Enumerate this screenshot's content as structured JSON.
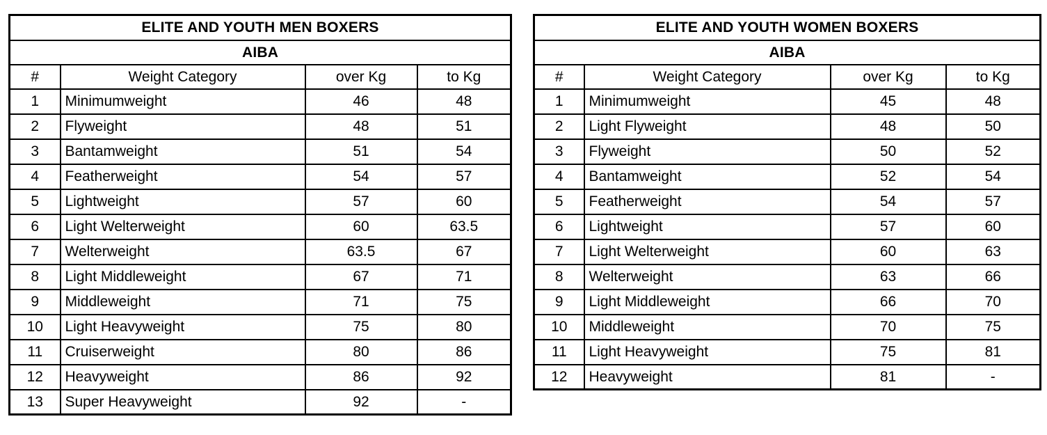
{
  "tables": [
    {
      "id": "men",
      "title": "ELITE AND YOUTH MEN BOXERS",
      "organization": "AIBA",
      "columns": {
        "index": "#",
        "category": "Weight Category",
        "over": "over Kg",
        "to": "to Kg"
      },
      "rows": [
        {
          "index": "1",
          "category": "Minimumweight",
          "over": "46",
          "to": "48"
        },
        {
          "index": "2",
          "category": "Flyweight",
          "over": "48",
          "to": "51"
        },
        {
          "index": "3",
          "category": "Bantamweight",
          "over": "51",
          "to": "54"
        },
        {
          "index": "4",
          "category": "Featherweight",
          "over": "54",
          "to": "57"
        },
        {
          "index": "5",
          "category": "Lightweight",
          "over": "57",
          "to": "60"
        },
        {
          "index": "6",
          "category": "Light Welterweight",
          "over": "60",
          "to": "63.5"
        },
        {
          "index": "7",
          "category": "Welterweight",
          "over": "63.5",
          "to": "67"
        },
        {
          "index": "8",
          "category": "Light Middleweight",
          "over": "67",
          "to": "71"
        },
        {
          "index": "9",
          "category": "Middleweight",
          "over": "71",
          "to": "75"
        },
        {
          "index": "10",
          "category": "Light Heavyweight",
          "over": "75",
          "to": "80"
        },
        {
          "index": "11",
          "category": "Cruiserweight",
          "over": "80",
          "to": "86"
        },
        {
          "index": "12",
          "category": "Heavyweight",
          "over": "86",
          "to": "92"
        },
        {
          "index": "13",
          "category": "Super Heavyweight",
          "over": "92",
          "to": "-"
        }
      ]
    },
    {
      "id": "women",
      "title": "ELITE AND YOUTH WOMEN BOXERS",
      "organization": "AIBA",
      "columns": {
        "index": "#",
        "category": "Weight Category",
        "over": "over Kg",
        "to": "to Kg"
      },
      "rows": [
        {
          "index": "1",
          "category": "Minimumweight",
          "over": "45",
          "to": "48"
        },
        {
          "index": "2",
          "category": "Light Flyweight",
          "over": "48",
          "to": "50"
        },
        {
          "index": "3",
          "category": "Flyweight",
          "over": "50",
          "to": "52"
        },
        {
          "index": "4",
          "category": "Bantamweight",
          "over": "52",
          "to": "54"
        },
        {
          "index": "5",
          "category": "Featherweight",
          "over": "54",
          "to": "57"
        },
        {
          "index": "6",
          "category": "Lightweight",
          "over": "57",
          "to": "60"
        },
        {
          "index": "7",
          "category": "Light Welterweight",
          "over": "60",
          "to": "63"
        },
        {
          "index": "8",
          "category": "Welterweight",
          "over": "63",
          "to": "66"
        },
        {
          "index": "9",
          "category": "Light Middleweight",
          "over": "66",
          "to": "70"
        },
        {
          "index": "10",
          "category": "Middleweight",
          "over": "70",
          "to": "75"
        },
        {
          "index": "11",
          "category": "Light Heavyweight",
          "over": "75",
          "to": "81"
        },
        {
          "index": "12",
          "category": "Heavyweight",
          "over": "81",
          "to": "-"
        }
      ]
    }
  ],
  "colors": {
    "border": "#000000",
    "text": "#000000",
    "background": "#ffffff"
  }
}
